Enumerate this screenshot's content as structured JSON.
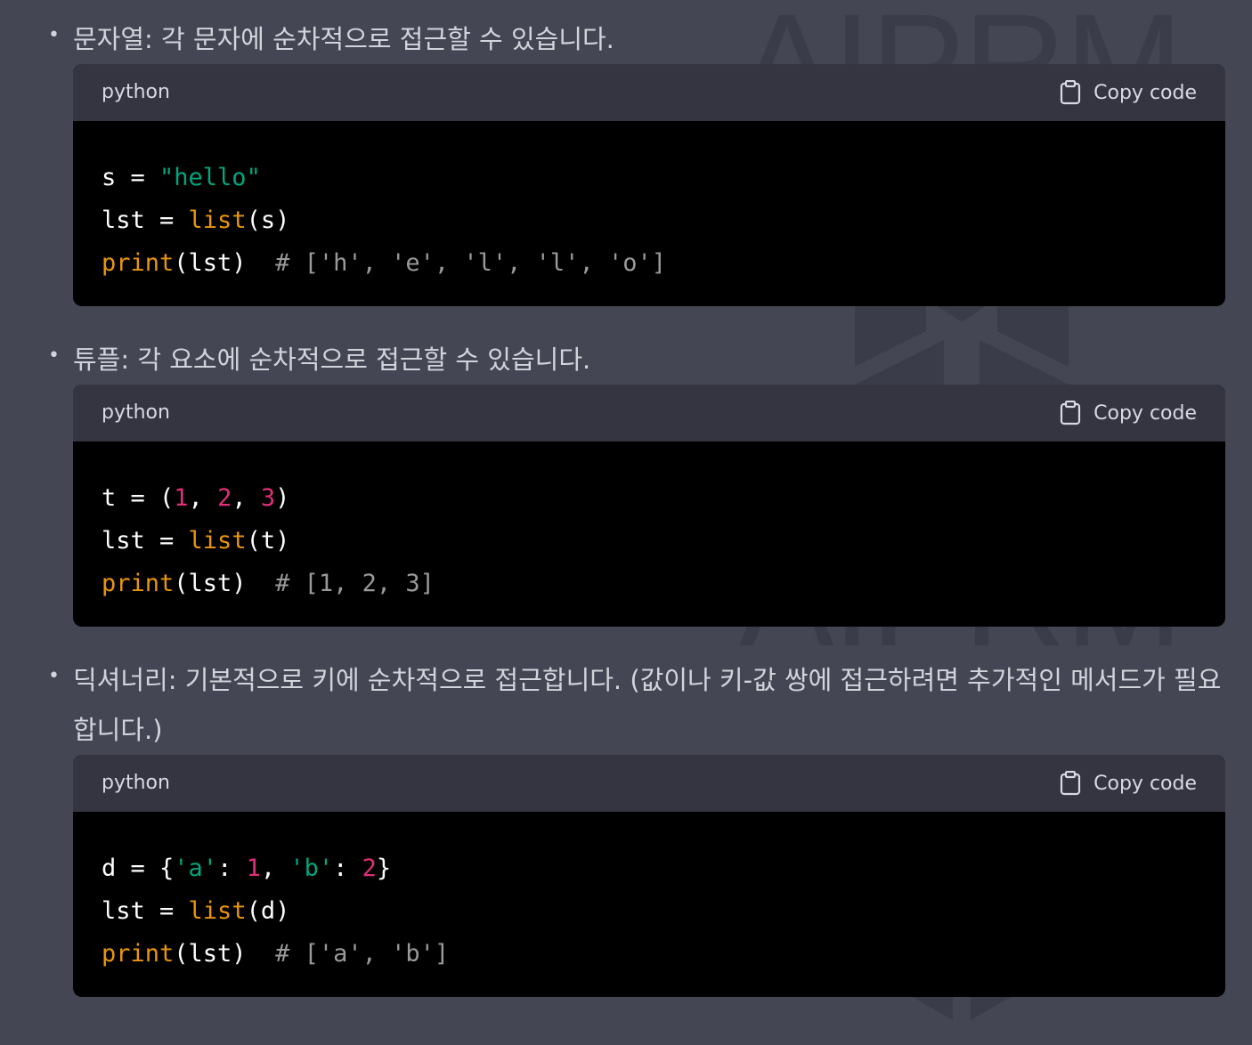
{
  "watermark": {
    "text": "AIPRM"
  },
  "items": [
    {
      "text": "문자열: 각 문자에 순차적으로 접근할 수 있습니다.",
      "code": {
        "language": "python",
        "copy_label": "Copy code",
        "lines": [
          [
            [
              "txt",
              "s = "
            ],
            [
              "str",
              "\"hello\""
            ]
          ],
          [
            [
              "txt",
              "lst = "
            ],
            [
              "fn",
              "list"
            ],
            [
              "txt",
              "(s)"
            ]
          ],
          [
            [
              "fn",
              "print"
            ],
            [
              "txt",
              "(lst)  "
            ],
            [
              "com",
              "# ['h', 'e', 'l', 'l', 'o']"
            ]
          ]
        ]
      }
    },
    {
      "text": "튜플: 각 요소에 순차적으로 접근할 수 있습니다.",
      "code": {
        "language": "python",
        "copy_label": "Copy code",
        "lines": [
          [
            [
              "txt",
              "t = ("
            ],
            [
              "num",
              "1"
            ],
            [
              "txt",
              ", "
            ],
            [
              "num",
              "2"
            ],
            [
              "txt",
              ", "
            ],
            [
              "num",
              "3"
            ],
            [
              "txt",
              ")"
            ]
          ],
          [
            [
              "txt",
              "lst = "
            ],
            [
              "fn",
              "list"
            ],
            [
              "txt",
              "(t)"
            ]
          ],
          [
            [
              "fn",
              "print"
            ],
            [
              "txt",
              "(lst)  "
            ],
            [
              "com",
              "# [1, 2, 3]"
            ]
          ]
        ]
      }
    },
    {
      "text": "딕셔너리: 기본적으로 키에 순차적으로 접근합니다. (값이나 키-값 쌍에 접근하려면 추가적인 메서드가 필요합니다.)",
      "code": {
        "language": "python",
        "copy_label": "Copy code",
        "lines": [
          [
            [
              "txt",
              "d = {"
            ],
            [
              "str",
              "'a'"
            ],
            [
              "txt",
              ": "
            ],
            [
              "num",
              "1"
            ],
            [
              "txt",
              ", "
            ],
            [
              "str",
              "'b'"
            ],
            [
              "txt",
              ": "
            ],
            [
              "num",
              "2"
            ],
            [
              "txt",
              "}"
            ]
          ],
          [
            [
              "txt",
              "lst = "
            ],
            [
              "fn",
              "list"
            ],
            [
              "txt",
              "(d)"
            ]
          ],
          [
            [
              "fn",
              "print"
            ],
            [
              "txt",
              "(lst)  "
            ],
            [
              "com",
              "# ['a', 'b']"
            ]
          ]
        ]
      }
    }
  ],
  "colors": {
    "background": "#444654",
    "code_header": "#343541",
    "code_body": "#000000",
    "string": "#00a67d",
    "function": "#e9950c",
    "number": "#df3079",
    "comment": "#9a9a9a"
  },
  "icons": {
    "copy": "clipboard-icon",
    "watermark_logo": "aiprm-logo-icon"
  }
}
